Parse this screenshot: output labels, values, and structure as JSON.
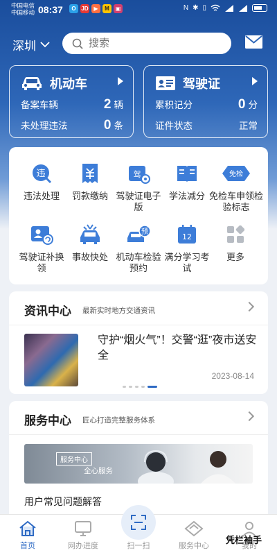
{
  "status_bar": {
    "carrier1": "中国电信",
    "carrier2": "中国移动",
    "time": "08:37",
    "notif_icons": [
      "iqiyi-icon",
      "jd-icon",
      "game-icon",
      "meituan-icon",
      "gallery-icon"
    ],
    "sys_icons": [
      "nfc-icon",
      "bluetooth-icon",
      "vibrate-icon",
      "wifi-icon",
      "4g-signal-icon",
      "4g-signal-icon",
      "battery-icon"
    ]
  },
  "header": {
    "city": "深圳",
    "search_placeholder": "搜索"
  },
  "vehicle_card": {
    "title": "机动车",
    "row1_label": "备案车辆",
    "row1_value": "2",
    "row1_unit": "辆",
    "row2_label": "未处理违法",
    "row2_value": "0",
    "row2_unit": "条"
  },
  "license_card": {
    "title": "驾驶证",
    "row1_label": "累积记分",
    "row1_value": "0",
    "row1_unit": "分",
    "row2_label": "证件状态",
    "row2_value": "正常"
  },
  "services": [
    {
      "label": "违法处理",
      "icon": "violation-icon",
      "badge": "违"
    },
    {
      "label": "罚款缴纳",
      "icon": "fine-payment-icon"
    },
    {
      "label": "驾驶证电子版",
      "icon": "e-license-icon",
      "badge": "驾"
    },
    {
      "label": "学法减分",
      "icon": "study-book-icon"
    },
    {
      "label": "免检车申领检验标志",
      "icon": "exempt-check-icon",
      "badge": "免检"
    },
    {
      "label": "驾驶证补换领",
      "icon": "license-renew-icon"
    },
    {
      "label": "事故快处",
      "icon": "accident-icon"
    },
    {
      "label": "机动车检验预约",
      "icon": "inspection-booking-icon",
      "badge": "预"
    },
    {
      "label": "满分学习考试",
      "icon": "calendar-exam-icon",
      "badge": "12"
    },
    {
      "label": "更多",
      "icon": "more-grid-icon"
    }
  ],
  "news": {
    "title": "资讯中心",
    "subtitle": "最新实时地方交通资讯",
    "headline": "守护“烟火气”！交警“逛”夜市送安全",
    "date": "2023-08-14"
  },
  "service_center": {
    "title": "服务中心",
    "subtitle": "匠心打造完整服务体系",
    "banner_tag": "服务中心",
    "banner_text": "全心服务",
    "faq": "用户常见问题解答"
  },
  "tabbar": [
    {
      "label": "首页",
      "icon": "home-icon",
      "active": true
    },
    {
      "label": "网办进度",
      "icon": "monitor-progress-icon",
      "active": false
    },
    {
      "label": "扫一扫",
      "icon": "scan-icon",
      "active": false
    },
    {
      "label": "服务中心",
      "icon": "diamond-service-icon",
      "active": false
    },
    {
      "label": "我的",
      "icon": "profile-icon",
      "active": false
    }
  ],
  "watermark": "凭栏袖手",
  "colors": {
    "primary": "#2f6bc4",
    "header_top": "#1a4d9c",
    "icon_blue": "#3d7dd8",
    "tab_active": "#2f6bc4",
    "tab_inactive": "#999999"
  }
}
